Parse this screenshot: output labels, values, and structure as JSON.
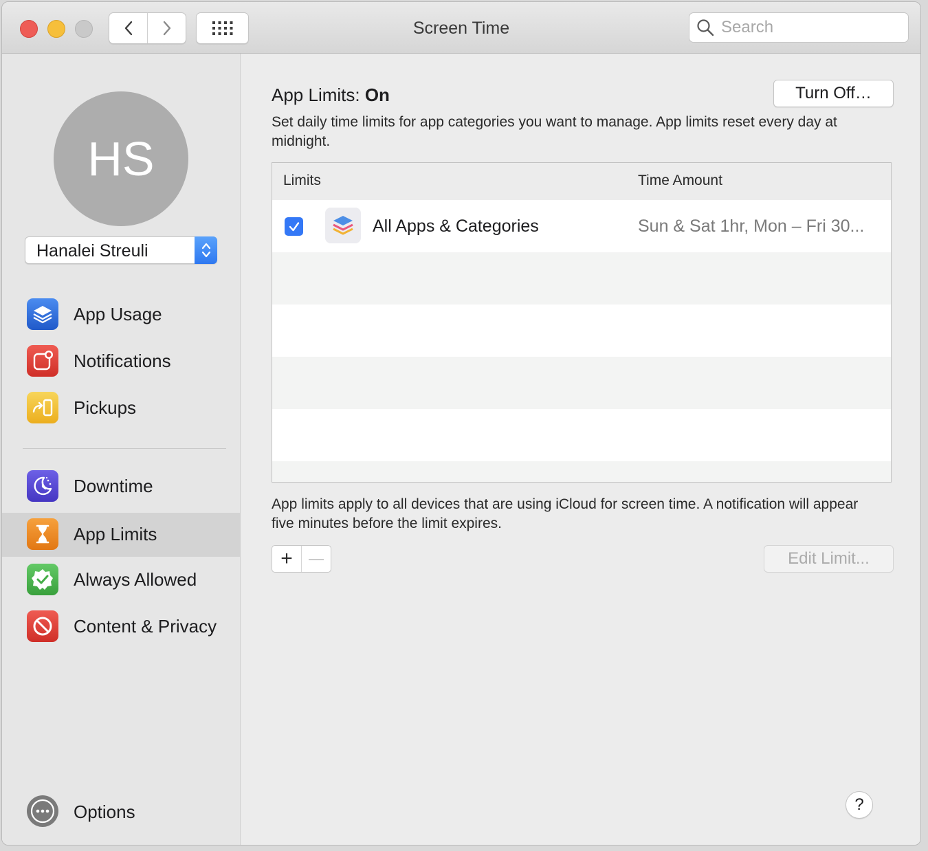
{
  "window": {
    "title": "Screen Time"
  },
  "search": {
    "placeholder": "Search"
  },
  "user": {
    "initials": "HS",
    "name": "Hanalei Streuli"
  },
  "sidebar": {
    "items": [
      {
        "label": "App Usage",
        "icon": "layers-icon",
        "color": "#2f6fe0",
        "selected": false
      },
      {
        "label": "Notifications",
        "icon": "notification-badge-icon",
        "color": "#e0443c",
        "selected": false
      },
      {
        "label": "Pickups",
        "icon": "pickup-phone-icon",
        "color": "#f2c13a",
        "selected": false
      },
      {
        "label": "Downtime",
        "icon": "moon-clock-icon",
        "color": "#5b4dd6",
        "selected": false
      },
      {
        "label": "App Limits",
        "icon": "hourglass-icon",
        "color": "#f08a24",
        "selected": true
      },
      {
        "label": "Always Allowed",
        "icon": "checkmark-seal-icon",
        "color": "#4bb54e",
        "selected": false
      },
      {
        "label": "Content & Privacy",
        "icon": "no-entry-icon",
        "color": "#e0443c",
        "selected": false
      }
    ],
    "options_label": "Options"
  },
  "main": {
    "heading_label": "App Limits: ",
    "heading_status": "On",
    "turn_off_button": "Turn Off…",
    "description": "Set daily time limits for app categories you want to manage. App limits reset every day at midnight.",
    "table": {
      "columns": [
        "Limits",
        "Time Amount"
      ],
      "rows": [
        {
          "checked": true,
          "name": "All Apps & Categories",
          "time": "Sun & Sat 1hr, Mon – Fri 30..."
        }
      ]
    },
    "footnote": "App limits apply to all devices that are using iCloud for screen time. A notification will appear five minutes before the limit expires.",
    "add_button": "+",
    "remove_button": "—",
    "edit_button": "Edit Limit...",
    "help_button": "?"
  }
}
